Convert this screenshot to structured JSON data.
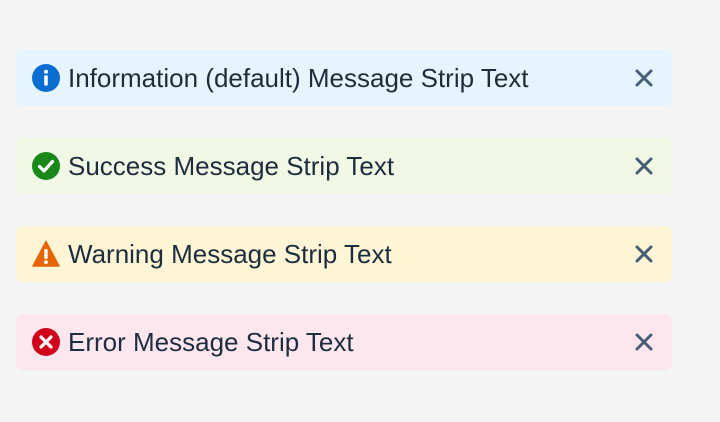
{
  "strips": [
    {
      "type": "information",
      "text": "Information (default) Message Strip Text",
      "icon": "info-icon",
      "icon_color": "#0a6ed1",
      "background": "#e5f4fd"
    },
    {
      "type": "success",
      "text": "Success Message Strip Text",
      "icon": "checkmark-circle-icon",
      "icon_color": "#188918",
      "background": "#f1f8e6"
    },
    {
      "type": "warning",
      "text": "Warning Message Strip Text",
      "icon": "warning-triangle-icon",
      "icon_color": "#e76500",
      "background": "#fdf5d6"
    },
    {
      "type": "error",
      "text": "Error Message Strip Text",
      "icon": "error-circle-icon",
      "icon_color": "#d0021b",
      "background": "#fde7ef"
    }
  ],
  "close_icon": "close-icon",
  "close_color": "#475e75"
}
